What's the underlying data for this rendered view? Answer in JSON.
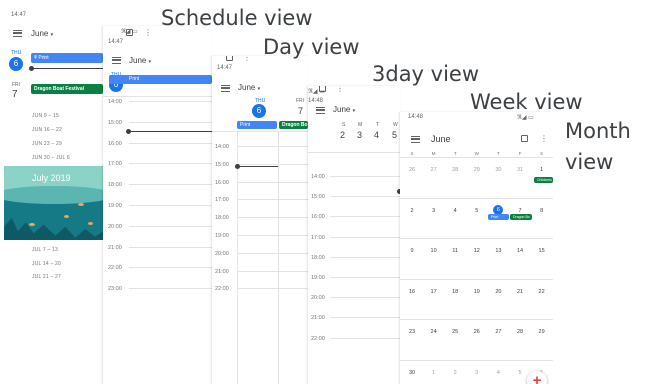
{
  "captions": {
    "schedule": "Schedule view",
    "day": "Day view",
    "three_day": "3day view",
    "week": "Week view",
    "month_line1": "Month",
    "month_line2": "view"
  },
  "schedule": {
    "time": "14:47",
    "month": "June",
    "day1_weekday": "THU",
    "day1_num": "6",
    "day1_event": "Print",
    "day2_weekday": "FRI",
    "day2_num": "7",
    "day2_event": "Dragon Boat Festival",
    "week_ranges": [
      "JUN 9 – 15",
      "JUN 16 – 22",
      "JUN 23 – 29",
      "JUN 30 – JUL 6"
    ],
    "banner": "July 2019",
    "week_ranges2": [
      "JUL 7 – 13",
      "JUL 14 – 20",
      "JUL 21 – 27"
    ]
  },
  "day": {
    "time": "14:47",
    "month": "June",
    "weekday": "THU",
    "daynum": "6",
    "event": "Print",
    "hours": [
      "14:00",
      "15:00",
      "16:00",
      "17:00",
      "18:00",
      "19:00",
      "20:00",
      "21:00",
      "22:00",
      "23:00"
    ]
  },
  "three_day": {
    "time": "14:47",
    "month": "June",
    "days": [
      {
        "wd": "THU",
        "num": "6"
      },
      {
        "wd": "FRI",
        "num": "7"
      }
    ],
    "events": [
      "Print",
      "Dragon Bo"
    ],
    "hours": [
      "14:00",
      "15:00",
      "16:00",
      "17:00",
      "18:00",
      "19:00",
      "20:00",
      "21:00",
      "22:00"
    ]
  },
  "week": {
    "time": "14:48",
    "month": "June",
    "days": [
      {
        "wd": "S",
        "num": "2"
      },
      {
        "wd": "M",
        "num": "3"
      },
      {
        "wd": "T",
        "num": "4"
      },
      {
        "wd": "W",
        "num": "5"
      }
    ],
    "hours": [
      "14:00",
      "15:00",
      "16:00",
      "17:00",
      "18:00",
      "19:00",
      "20:00",
      "21:00",
      "22:00"
    ]
  },
  "month": {
    "time": "14:48",
    "month": "June",
    "weekdays": [
      "S",
      "M",
      "T",
      "W",
      "T",
      "F",
      "S"
    ],
    "rows": [
      [
        "26",
        "27",
        "28",
        "29",
        "30",
        "31",
        "1"
      ],
      [
        "2",
        "3",
        "4",
        "5",
        "6",
        "7",
        "8"
      ],
      [
        "9",
        "10",
        "11",
        "12",
        "13",
        "14",
        "15"
      ],
      [
        "16",
        "17",
        "18",
        "19",
        "20",
        "21",
        "22"
      ],
      [
        "23",
        "24",
        "25",
        "26",
        "27",
        "28",
        "29"
      ],
      [
        "30",
        "1",
        "2",
        "3",
        "4",
        "5",
        "6"
      ]
    ],
    "event_childrens": "Childrens",
    "event_print": "Print",
    "event_dragon": "Dragon Bo",
    "fab": "+"
  }
}
